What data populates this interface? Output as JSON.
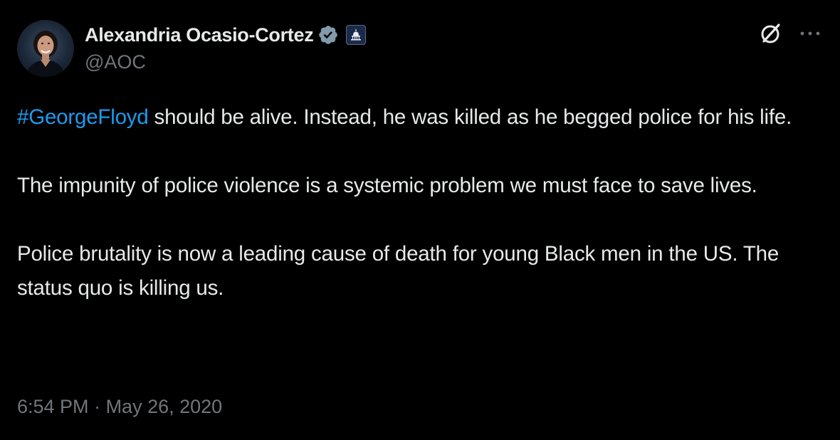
{
  "author": {
    "display_name": "Alexandria Ocasio-Cortez",
    "handle": "@AOC",
    "verified": true,
    "affiliation_badge": "government-capitol-icon"
  },
  "header_actions": {
    "grok_icon": "grok-slash-circle-icon",
    "more_icon": "more-horizontal-icon",
    "more_label": "···"
  },
  "tweet": {
    "hashtag": "#GeorgeFloyd",
    "paragraph1_rest": " should be alive. Instead, he was killed as he begged police for his life.",
    "paragraph2": "The impunity of police violence is a systemic problem we must face to save lives.",
    "paragraph3": "Police brutality is now a leading cause of death for young Black men in the US. The status quo is killing us."
  },
  "timestamp": {
    "time": "6:54 PM",
    "separator": " · ",
    "date": "May 26, 2020"
  },
  "colors": {
    "background": "#000000",
    "text_primary": "#e7e9ea",
    "text_secondary": "#71767b",
    "link": "#1d9bf0",
    "verified_badge": "#829aab"
  }
}
